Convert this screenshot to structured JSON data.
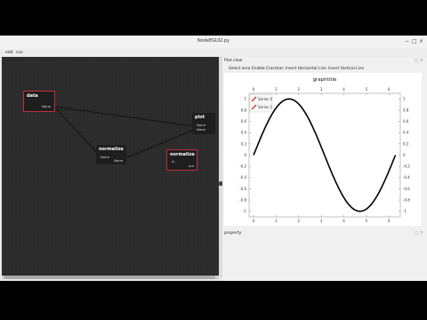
{
  "window": {
    "title": "NodeEGUI2.py",
    "controls": [
      "−",
      "□",
      "×"
    ]
  },
  "menu": [
    "edit",
    "run"
  ],
  "nodes": [
    {
      "id": "data",
      "title": "data",
      "ports_out": [
        "None"
      ],
      "selected": true
    },
    {
      "id": "normalize1",
      "title": "normalize",
      "ports_in": [
        "None"
      ],
      "ports_out": [
        "None"
      ],
      "selected": false
    },
    {
      "id": "plot",
      "title": "plot",
      "ports_in": [
        "None",
        "None"
      ],
      "selected": false
    },
    {
      "id": "normalize2",
      "title": "normalize",
      "ports_in": [
        "in"
      ],
      "ports_out": [
        "out"
      ],
      "selected": true
    }
  ],
  "plot_dock": {
    "title": "Plot view",
    "toolbar": [
      "Select area",
      "Enable Crosshair",
      "Insert Horizontal Line",
      "Insert Vertical Line"
    ],
    "dock_buttons": [
      "◻",
      "×"
    ]
  },
  "property_dock": {
    "title": "property",
    "dock_buttons": [
      "◻",
      "×"
    ]
  },
  "chart_data": {
    "type": "line",
    "title": "graphtitle",
    "x": [
      0,
      0.5,
      1,
      1.5,
      1.5708,
      2,
      2.5,
      3,
      3.1416,
      3.5,
      4,
      4.5,
      4.7124,
      5,
      5.5,
      6,
      6.2832
    ],
    "series": [
      {
        "name": "Series 0",
        "values": [
          0,
          0.479,
          0.841,
          0.997,
          1.0,
          0.909,
          0.598,
          0.141,
          0.0,
          -0.351,
          -0.757,
          -0.978,
          -1.0,
          -0.959,
          -0.706,
          -0.279,
          0.0
        ],
        "color": "#000000"
      },
      {
        "name": "Series 1",
        "values": [],
        "color": "#c00000"
      }
    ],
    "xticks": [
      "0",
      "1",
      "2",
      "3",
      "4",
      "5",
      "6"
    ],
    "yticks": [
      "1",
      "0.8",
      "0.6",
      "0.4",
      "0.2",
      "0",
      "-0.2",
      "-0.4",
      "-0.6",
      "-0.8",
      "-1"
    ],
    "xlim": [
      -0.2,
      6.5
    ],
    "ylim": [
      -1.1,
      1.1
    ],
    "grid": false,
    "legend": "top-left",
    "mirrored_axes": true
  }
}
